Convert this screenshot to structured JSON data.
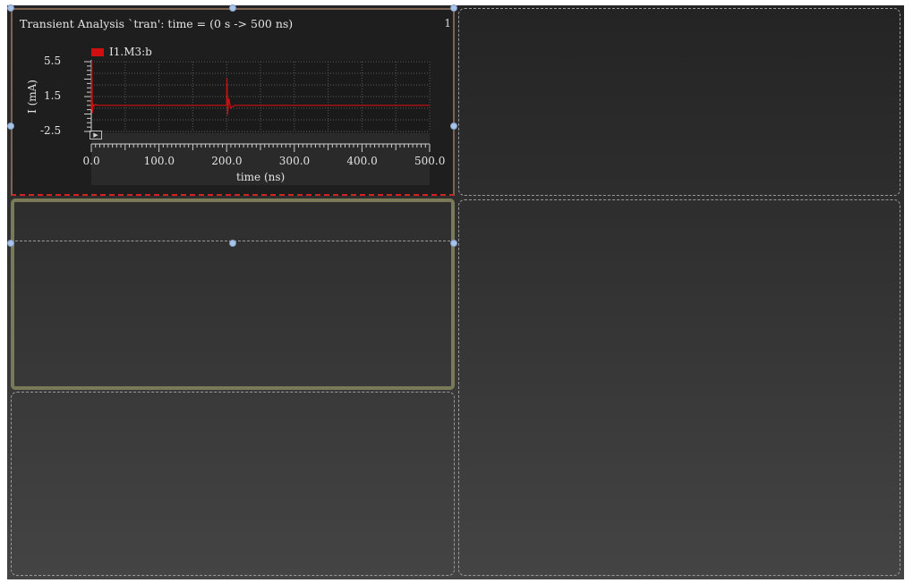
{
  "window": {
    "plot_title": "Transient Analysis `tran': time = (0 s -> 500 ns)",
    "corner_label": "1"
  },
  "chart_data": {
    "type": "line",
    "title": "Transient Analysis `tran': time = (0 s -> 500 ns)",
    "xlabel": "time (ns)",
    "ylabel": "I (mA)",
    "xlim": [
      0,
      500
    ],
    "ylim": [
      -2.5,
      5.5
    ],
    "x_ticks": [
      "0.0",
      "100.0",
      "200.0",
      "300.0",
      "400.0",
      "500.0"
    ],
    "y_ticks": [
      "5.5",
      "1.5",
      "-2.5"
    ],
    "grid": true,
    "legend_position": "top-left",
    "series": [
      {
        "name": "I1.M3:b",
        "color": "#d01010",
        "x": [
          0,
          0.8,
          1.6,
          2.4,
          4,
          6,
          10,
          50,
          100,
          150,
          199,
          200,
          200.5,
          201.5,
          203,
          206,
          212,
          250,
          300,
          400,
          500
        ],
        "y": [
          0,
          5.6,
          -0.4,
          0.7,
          0.4,
          0.6,
          0.5,
          0.5,
          0.5,
          0.5,
          0.5,
          0.5,
          3.6,
          -0.6,
          1.3,
          0.2,
          0.5,
          0.5,
          0.5,
          0.5,
          0.5
        ]
      }
    ]
  },
  "icons": {
    "play": "play-icon",
    "play_glyph": "▶"
  }
}
